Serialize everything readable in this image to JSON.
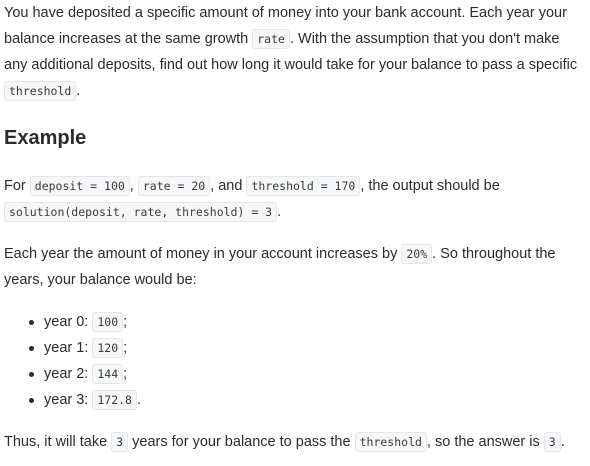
{
  "intro": {
    "t1": "You have deposited a specific amount of money into your bank account. Each year your balance increases at the same growth ",
    "c1": "rate",
    "t2": ". With the assumption that you don't make any additional deposits, find out how long it would take for your balance to pass a specific ",
    "c2": "threshold",
    "t3": "."
  },
  "example_heading": "Example",
  "example": {
    "t1": "For ",
    "c1": "deposit = 100",
    "t2": ", ",
    "c2": "rate = 20",
    "t3": ", and ",
    "c3": "threshold = 170",
    "t4": ", the output should be ",
    "c4": "solution(deposit, rate, threshold) = 3",
    "t5": "."
  },
  "growth": {
    "t1": "Each year the amount of money in your account increases by ",
    "c1": "20%",
    "t2": ". So throughout the years, your balance would be:"
  },
  "years": [
    {
      "label": "year 0: ",
      "value": "100",
      "end": ";"
    },
    {
      "label": "year 1: ",
      "value": "120",
      "end": ";"
    },
    {
      "label": "year 2: ",
      "value": "144",
      "end": ";"
    },
    {
      "label": "year 3: ",
      "value": "172.8",
      "end": "."
    }
  ],
  "conclusion": {
    "t1": "Thus, it will take ",
    "c1": "3",
    "t2": " years for your balance to pass the ",
    "c2": "threshold",
    "t3": ", so the answer is ",
    "c3": "3",
    "t4": "."
  }
}
